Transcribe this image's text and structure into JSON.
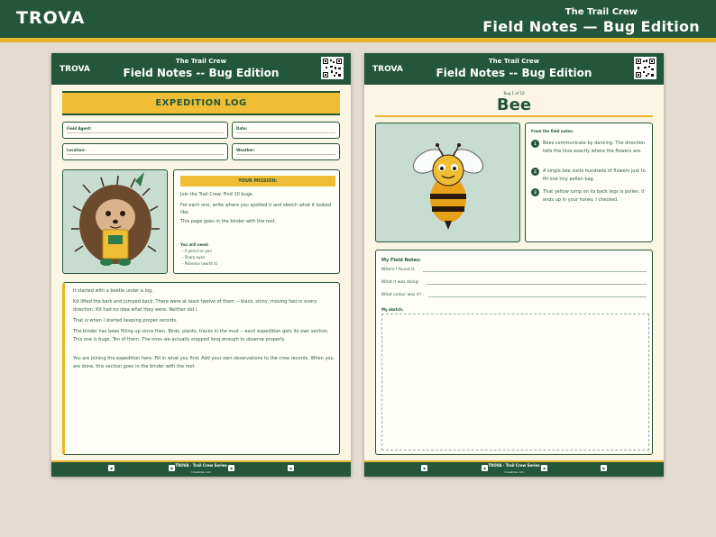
{
  "top_banner": {
    "logo": "TROVA",
    "series": "The Trail Crew",
    "title": "Field Notes — Bug Edition"
  },
  "page_header": {
    "logo": "TROVA",
    "series": "The Trail Crew",
    "title": "Field Notes -- Bug Edition"
  },
  "page_footer": {
    "series": "TROVA · Trail Crew Series",
    "site": "trovakids.com"
  },
  "left_page": {
    "banner": "EXPEDITION LOG",
    "fields": {
      "agent": "Field Agent:",
      "date": "Date:",
      "location": "Location:",
      "weather": "Weather:"
    },
    "mission": {
      "heading": "YOUR MISSION:",
      "lines": [
        "Join the Trail Crew. Find 10 bugs.",
        "For each one, write where you spotted it and sketch what it looked like.",
        "This page goes in the binder with the rest."
      ],
      "need_heading": "You will need:",
      "needs": [
        "- A pencil or pen",
        "- Sharp eyes",
        "- Patience (worth it)"
      ]
    },
    "story": [
      "It started with a beetle under a log.",
      "Kit lifted the bark and jumped back. There were at least twelve of them -- black, shiny, moving fast in every direction. Kit had no idea what they were. Neither did I.",
      "That is when I started keeping proper records.",
      "The binder has been filling up since then. Birds, plants, tracks in the mud -- each expedition gets its own section. This one is bugs. Ten of them. The ones we actually stopped long enough to observe properly.",
      "You are joining the expedition here. Fill in what you find. Add your own observations to the crew records. When you are done, this section goes in the binder with the rest."
    ]
  },
  "right_page": {
    "counter": "Bug 1 of 10",
    "bug_name": "Bee",
    "facts_heading": "From the field notes:",
    "facts": [
      {
        "num": "1",
        "text": "Bees communicate by dancing. The direction tells the hive exactly where the flowers are."
      },
      {
        "num": "2",
        "text": "A single bee visits hundreds of flowers just to fill one tiny pollen bag."
      },
      {
        "num": "3",
        "text": "That yellow lump on its back legs is pollen. It ends up in your honey. I checked."
      }
    ],
    "notes_heading": "My Field Notes:",
    "notes_prompts": [
      "Where I found it:",
      "What it was doing:",
      "What colour was it?"
    ],
    "sketch_label": "My sketch:"
  },
  "colors": {
    "green": "#23563a",
    "yellow": "#e8b52a",
    "paper": "#fbf6e4",
    "background": "#e4dcd0"
  }
}
